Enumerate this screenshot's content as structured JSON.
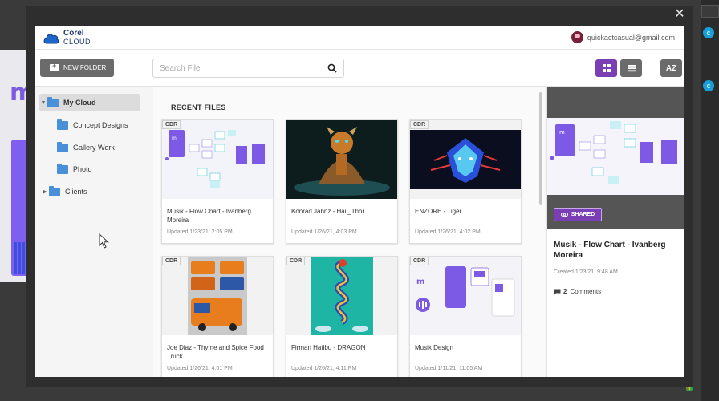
{
  "app": {
    "brand_line1": "Corel",
    "brand_line2": "CLOUD",
    "user_email": "quickactcasual@gmail.com",
    "colors": {
      "accent": "#7b3fb5",
      "folder": "#4a90d9",
      "button_gray": "#6b6b6b"
    }
  },
  "background_app": {
    "letter": "m",
    "right_dot_letter": "c"
  },
  "toolbar": {
    "new_folder_label": "NEW FOLDER",
    "search_placeholder": "Search File",
    "sort_label": "AZ"
  },
  "sidebar": {
    "root": "My Cloud",
    "items": [
      {
        "label": "Concept Designs"
      },
      {
        "label": "Gallery Work"
      },
      {
        "label": "Photo"
      },
      {
        "label": "Clients"
      }
    ]
  },
  "main": {
    "section_title": "RECENT FILES",
    "files": [
      {
        "type": "CDR",
        "name": "Musik - Flow Chart - Ivanberg Moreira",
        "updated": "Updated 1/23/21, 2:05 PM",
        "thumb_icon": "flowchart-thumbnail"
      },
      {
        "type": "CDR",
        "name": "Konrad Jahnz - Hail_Thor",
        "updated": "Updated 1/26/21, 4:03 PM",
        "thumb_icon": "thor-artwork-thumbnail"
      },
      {
        "type": "CDR",
        "name": "ENZORE - Tiger",
        "updated": "Updated 1/26/21, 4:02 PM",
        "thumb_icon": "tiger-artwork-thumbnail"
      },
      {
        "type": "CDR",
        "name": "Joe Diaz - Thyme and Spice Food Truck",
        "updated": "Updated 1/26/21, 4:01 PM",
        "thumb_icon": "food-truck-thumbnail"
      },
      {
        "type": "CDR",
        "name": "Firman Hatibu - DRAGON",
        "updated": "Updated 1/26/21, 4:11 PM",
        "thumb_icon": "dragon-artwork-thumbnail"
      },
      {
        "type": "CDR",
        "name": "Musik Design",
        "updated": "Updated 1/11/21, 11:05 AM",
        "thumb_icon": "musik-app-thumbnail"
      }
    ]
  },
  "details": {
    "shared_label": "SHARED",
    "title": "Musik - Flow Chart - Ivanberg Moreira",
    "created": "Created 1/23/21, 9:48 AM",
    "comments_count": "2",
    "comments_label": "Comments"
  }
}
